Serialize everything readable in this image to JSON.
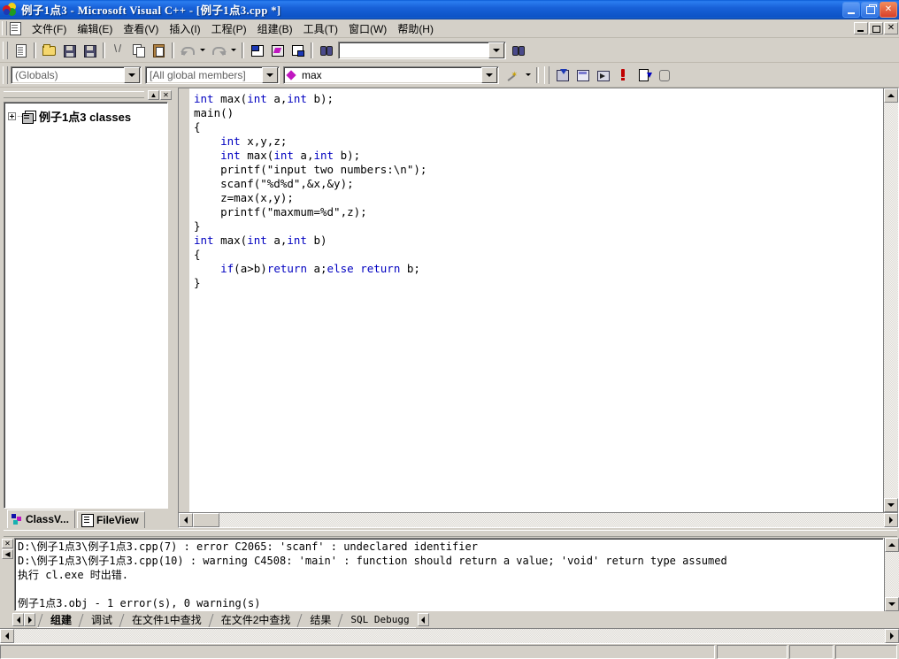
{
  "window": {
    "title": "例子1点3 - Microsoft Visual C++ - [例子1点3.cpp *]",
    "app_icon": "vcpp-icon",
    "minimize_label": "",
    "restore_label": "",
    "close_label": "✕"
  },
  "menu": {
    "icon": "document-icon",
    "items": [
      {
        "label": "文件(F)"
      },
      {
        "label": "编辑(E)"
      },
      {
        "label": "查看(V)"
      },
      {
        "label": "插入(I)"
      },
      {
        "label": "工程(P)"
      },
      {
        "label": "组建(B)"
      },
      {
        "label": "工具(T)"
      },
      {
        "label": "窗口(W)"
      },
      {
        "label": "帮助(H)"
      }
    ],
    "mdi_close_label": "✕"
  },
  "standard_toolbar": {
    "buttons": [
      {
        "name": "new-text-file-button",
        "icon": "new-file-icon"
      },
      {
        "name": "open-button",
        "icon": "open-folder-icon"
      },
      {
        "name": "save-button",
        "icon": "save-disk-icon"
      },
      {
        "name": "save-all-button",
        "icon": "save-all-icon"
      },
      {
        "name": "cut-button",
        "icon": "scissors-icon"
      },
      {
        "name": "copy-button",
        "icon": "copy-icon"
      },
      {
        "name": "paste-button",
        "icon": "paste-icon"
      },
      {
        "name": "undo-button",
        "icon": "undo-arrow-icon"
      },
      {
        "name": "redo-button",
        "icon": "redo-arrow-icon"
      },
      {
        "name": "workspace-button",
        "icon": "workspace-window-icon"
      },
      {
        "name": "output-button",
        "icon": "output-window-icon"
      },
      {
        "name": "window-list-button",
        "icon": "window-list-icon"
      },
      {
        "name": "find-in-files-button",
        "icon": "binoculars-icon"
      }
    ],
    "find_combo": {
      "value": "",
      "placeholder": ""
    },
    "search_button_icon": "binoculars-find-icon"
  },
  "wizard_bar": {
    "class_combo": {
      "value": "(Globals)",
      "icon": "chevron-down-icon"
    },
    "members_combo": {
      "value": "[All global members]",
      "icon": "chevron-down-icon"
    },
    "function_combo": {
      "value": "max",
      "symbol_icon": "pink-diamond-icon",
      "icon": "chevron-down-icon"
    },
    "actions_button_icon": "magic-wand-icon"
  },
  "build_toolbar": {
    "buttons": [
      {
        "name": "compile-button",
        "icon": "compile-icon"
      },
      {
        "name": "build-button",
        "icon": "build-icon"
      },
      {
        "name": "execute-program-button",
        "icon": "execute-icon"
      },
      {
        "name": "insert-remove-breakpoint-button",
        "icon": "breakpoint-icon"
      },
      {
        "name": "go-button",
        "icon": "go-icon"
      },
      {
        "name": "stop-build-button",
        "icon": "hand-stop-icon"
      }
    ]
  },
  "workspace": {
    "caption_buttons": {
      "minimize": "▲",
      "close": "✕"
    },
    "tree": {
      "expander": "+",
      "icon": "classes-folder-icon",
      "root_label": "例子1点3 classes"
    },
    "tabs": [
      {
        "label": "ClassV...",
        "icon": "class-view-icon",
        "active": true
      },
      {
        "label": "FileView",
        "icon": "file-view-icon",
        "active": false
      }
    ]
  },
  "editor": {
    "filename": "例子1点3.cpp",
    "code_lines": [
      [
        {
          "t": "int",
          "k": true
        },
        {
          "t": " max(",
          "k": false
        },
        {
          "t": "int",
          "k": true
        },
        {
          "t": " a,",
          "k": false
        },
        {
          "t": "int",
          "k": true
        },
        {
          "t": " b);",
          "k": false
        }
      ],
      [
        {
          "t": "main()",
          "k": false
        }
      ],
      [
        {
          "t": "{",
          "k": false
        }
      ],
      [
        {
          "t": "    ",
          "k": false
        },
        {
          "t": "int",
          "k": true
        },
        {
          "t": " x,y,z;",
          "k": false
        }
      ],
      [
        {
          "t": "    ",
          "k": false
        },
        {
          "t": "int",
          "k": true
        },
        {
          "t": " max(",
          "k": false
        },
        {
          "t": "int",
          "k": true
        },
        {
          "t": " a,",
          "k": false
        },
        {
          "t": "int",
          "k": true
        },
        {
          "t": " b);",
          "k": false
        }
      ],
      [
        {
          "t": "    printf(\"input two numbers:\\n\");",
          "k": false
        }
      ],
      [
        {
          "t": "    scanf(\"%d%d\",&x,&y);",
          "k": false
        }
      ],
      [
        {
          "t": "    z=max(x,y);",
          "k": false
        }
      ],
      [
        {
          "t": "    printf(\"maxmum=%d\",z);",
          "k": false
        }
      ],
      [
        {
          "t": "}",
          "k": false
        }
      ],
      [
        {
          "t": "int",
          "k": true
        },
        {
          "t": " max(",
          "k": false
        },
        {
          "t": "int",
          "k": true
        },
        {
          "t": " a,",
          "k": false
        },
        {
          "t": "int",
          "k": true
        },
        {
          "t": " b)",
          "k": false
        }
      ],
      [
        {
          "t": "{",
          "k": false
        }
      ],
      [
        {
          "t": "    ",
          "k": false
        },
        {
          "t": "if",
          "k": true
        },
        {
          "t": "(a>b)",
          "k": false
        },
        {
          "t": "return",
          "k": true
        },
        {
          "t": " a;",
          "k": false
        },
        {
          "t": "else",
          "k": true
        },
        {
          "t": " ",
          "k": false
        },
        {
          "t": "return",
          "k": true
        },
        {
          "t": " b;",
          "k": false
        }
      ],
      [
        {
          "t": "}",
          "k": false
        }
      ]
    ],
    "keyword_color": "#0000c0",
    "text_color": "#000000",
    "background_color": "#ffffff"
  },
  "output": {
    "caption_buttons": {
      "close": "✕",
      "minimize": "◀"
    },
    "lines": [
      "D:\\例子1点3\\例子1点3.cpp(7) : error C2065: 'scanf' : undeclared identifier",
      "D:\\例子1点3\\例子1点3.cpp(10) : warning C4508: 'main' : function should return a value; 'void' return type assumed",
      "执行 cl.exe 时出错.",
      "",
      "例子1点3.obj - 1 error(s), 0 warning(s)"
    ],
    "tabs": [
      {
        "label": "组建",
        "active": true
      },
      {
        "label": "调试",
        "active": false
      },
      {
        "label": "在文件1中查找",
        "active": false
      },
      {
        "label": "在文件2中查找",
        "active": false
      },
      {
        "label": "结果",
        "active": false
      },
      {
        "label": "SQL Debugg",
        "active": false
      }
    ],
    "nav_prev": "◀",
    "nav_next": "▶",
    "scroll_left": "◀",
    "scroll_right": "▶"
  },
  "statusbar": {
    "message": "",
    "cells": [
      "",
      "",
      ""
    ]
  }
}
